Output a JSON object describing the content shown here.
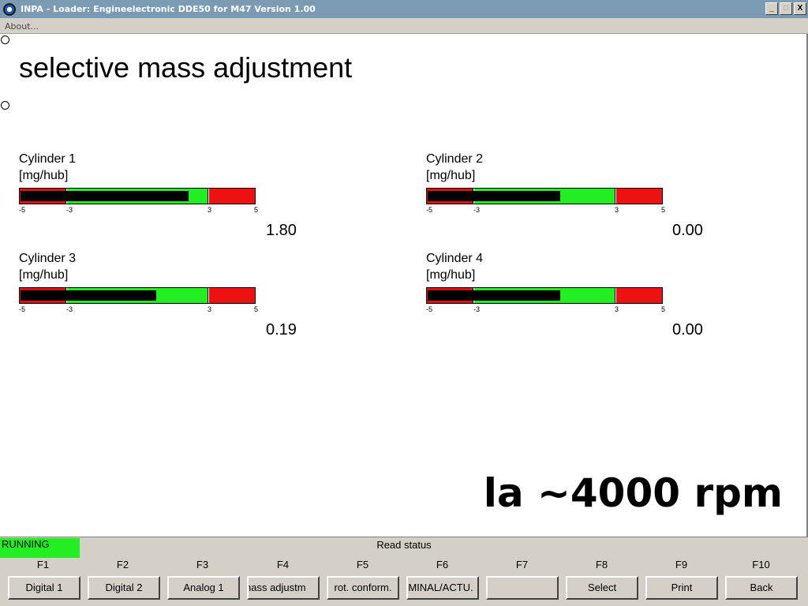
{
  "window": {
    "title": "INPA - Loader:  Engineelectronic DDE50 for M47 Version 1.00",
    "buttons": [
      "_",
      "□",
      "X"
    ]
  },
  "menu": {
    "about": "About..."
  },
  "main": {
    "title": "selective mass adjustment",
    "note": "la ~4000 rpm",
    "colors": {
      "red": "#e01010",
      "green": "#22ee22",
      "bar": "#000000"
    },
    "cylinders": [
      {
        "name": "Cylinder 1",
        "unit": "[mg/hub]",
        "value": "1.80",
        "bar_value": 1.8,
        "ticks": [
          "-5",
          "-3",
          "3",
          "5"
        ]
      },
      {
        "name": "Cylinder 2",
        "unit": "[mg/hub]",
        "value": "0.00",
        "bar_value": 0.0,
        "ticks": [
          "-5",
          "-3",
          "3",
          "5"
        ]
      },
      {
        "name": "Cylinder 3",
        "unit": "[mg/hub]",
        "value": "0.19",
        "bar_value": 0.19,
        "ticks": [
          "-5",
          "-3",
          "3",
          "5"
        ]
      },
      {
        "name": "Cylinder 4",
        "unit": "[mg/hub]",
        "value": "0.00",
        "bar_value": 0.0,
        "ticks": [
          "-5",
          "-3",
          "3",
          "5"
        ]
      }
    ]
  },
  "status": {
    "state": "RUNNING",
    "message": "Read status"
  },
  "fkeys": [
    {
      "key": "F1",
      "label": "Digital 1"
    },
    {
      "key": "F2",
      "label": "Digital 2"
    },
    {
      "key": "F3",
      "label": "Analog 1"
    },
    {
      "key": "F4",
      "label": "nass adjustm"
    },
    {
      "key": "F5",
      "label": "rot. conform."
    },
    {
      "key": "F6",
      "label": ")MINAL/ACTU."
    },
    {
      "key": "F7",
      "label": ""
    },
    {
      "key": "F8",
      "label": "Select"
    },
    {
      "key": "F9",
      "label": "Print"
    },
    {
      "key": "F10",
      "label": "Back"
    }
  ]
}
